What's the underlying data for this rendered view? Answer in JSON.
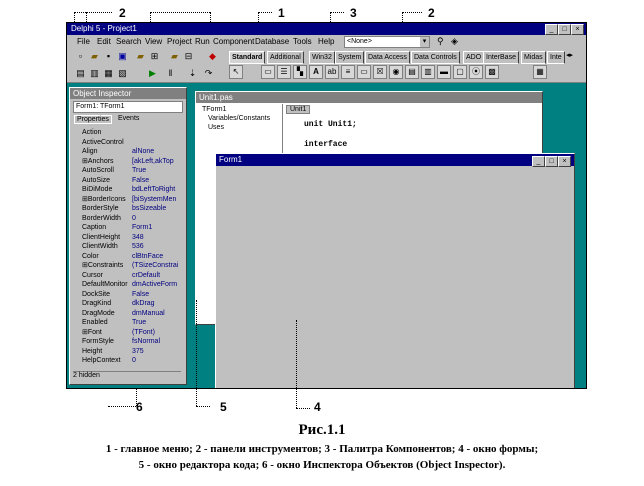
{
  "ide": {
    "title": "Delphi 5 - Project1",
    "menu": [
      "File",
      "Edit",
      "Search",
      "View",
      "Project",
      "Run",
      "Component",
      "Database",
      "Tools",
      "Help"
    ],
    "none_combo": "<None>",
    "palette_tabs": [
      "Standard",
      "Additional",
      "Win32",
      "System",
      "Data Access",
      "Data Controls",
      "ADO",
      "InterBase",
      "Midas",
      "Inte"
    ]
  },
  "inspector": {
    "title": "Object Inspector",
    "object": "Form1: TForm1",
    "tabs": [
      "Properties",
      "Events"
    ],
    "rows": [
      {
        "k": "Action",
        "v": ""
      },
      {
        "k": "ActiveControl",
        "v": ""
      },
      {
        "k": "Align",
        "v": "alNone"
      },
      {
        "k": "⊞Anchors",
        "v": "[akLeft,akTop"
      },
      {
        "k": "AutoScroll",
        "v": "True"
      },
      {
        "k": "AutoSize",
        "v": "False"
      },
      {
        "k": "BiDiMode",
        "v": "bdLeftToRight"
      },
      {
        "k": "⊞BorderIcons",
        "v": "[biSystemMen"
      },
      {
        "k": "BorderStyle",
        "v": "bsSizeable"
      },
      {
        "k": "BorderWidth",
        "v": "0"
      },
      {
        "k": "Caption",
        "v": "Form1"
      },
      {
        "k": "ClientHeight",
        "v": "348"
      },
      {
        "k": "ClientWidth",
        "v": "536"
      },
      {
        "k": "Color",
        "v": "clBtnFace"
      },
      {
        "k": "⊞Constraints",
        "v": "(TSizeConstraints)"
      },
      {
        "k": "Cursor",
        "v": "crDefault"
      },
      {
        "k": "DefaultMonitor",
        "v": "dmActiveForm"
      },
      {
        "k": "DockSite",
        "v": "False"
      },
      {
        "k": "DragKind",
        "v": "dkDrag"
      },
      {
        "k": "DragMode",
        "v": "dmManual"
      },
      {
        "k": "Enabled",
        "v": "True"
      },
      {
        "k": "⊞Font",
        "v": "(TFont)"
      },
      {
        "k": "FormStyle",
        "v": "fsNormal"
      },
      {
        "k": "Height",
        "v": "375"
      },
      {
        "k": "HelpContext",
        "v": "0"
      }
    ],
    "status": "2 hidden"
  },
  "editor": {
    "title": "Unit1.pas",
    "tree_root": "TForm1",
    "tree_items": [
      "Variables/Constants",
      "Uses"
    ],
    "tab": "Unit1",
    "code": [
      "unit Unit1;",
      "interface"
    ]
  },
  "form": {
    "title": "Form1"
  },
  "callouts": {
    "n1": "1",
    "n2a": "2",
    "n2b": "2",
    "n3": "3",
    "n4": "4",
    "n5": "5",
    "n6": "6"
  },
  "caption": {
    "title": "Рис.1.1",
    "line1": "1 - главное меню; 2 - панели инструментов; 3 - Палитра Компонентов; 4 - окно формы;",
    "line2": "5 - окно редактора кода; 6 - окно Инспектора Объектов (Object Inspector)."
  }
}
